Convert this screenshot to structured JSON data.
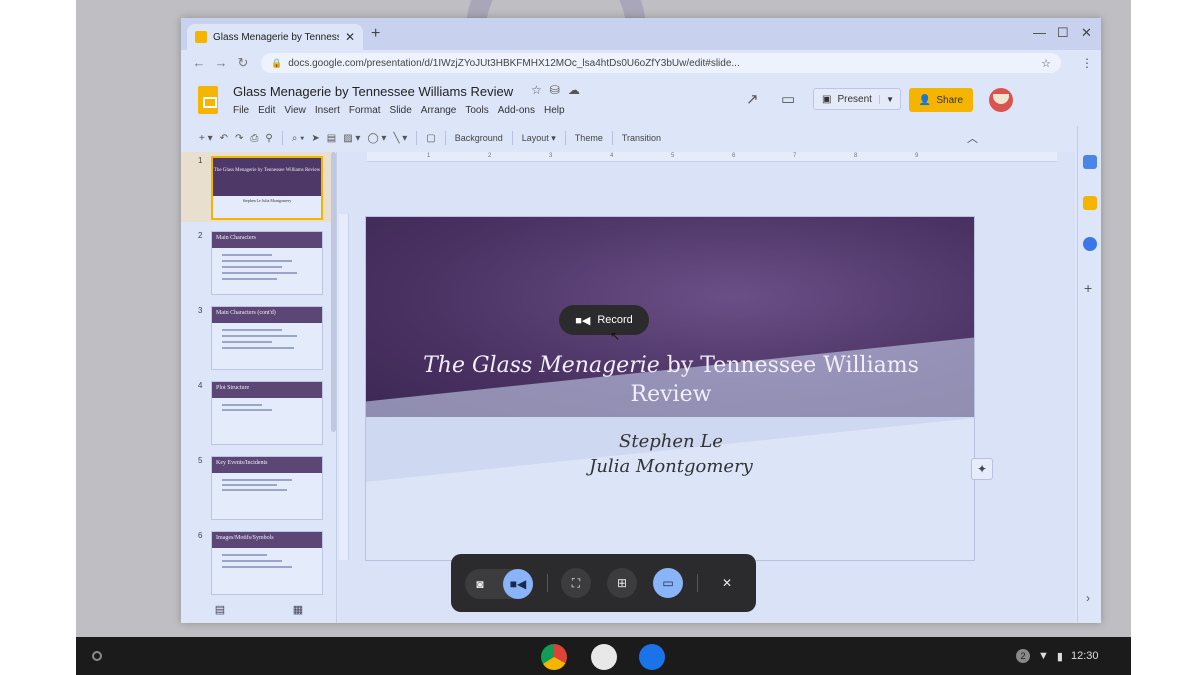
{
  "browser": {
    "tab_title": "Glass Menagerie by Tennessee Williams Review",
    "tab_close": "✕",
    "new_tab": "+",
    "url": "docs.google.com/presentation/d/1IWzjZYoJUt3HBKFMHX12MOc_lsa4htDs0U6oZfY3bUw/edit#slide...",
    "window_controls": [
      "—",
      "☐",
      "✕"
    ]
  },
  "docs": {
    "title": "Glass Menagerie by Tennessee Williams Review",
    "menu": [
      "File",
      "Edit",
      "View",
      "Insert",
      "Format",
      "Slide",
      "Arrange",
      "Tools",
      "Add-ons",
      "Help"
    ],
    "present_label": "Present",
    "share_label": "Share",
    "accent_color": "#f4b400"
  },
  "toolbar": {
    "background_label": "Background",
    "layout_label": "Layout ▾",
    "theme_label": "Theme",
    "transition_label": "Transition"
  },
  "filmstrip": {
    "slides": [
      {
        "num": "1",
        "title": "The Glass Menagerie by Tennessee Williams Review",
        "subtitle": "Stephen Le Julia Montgomery"
      },
      {
        "num": "2",
        "title": "Main Characters"
      },
      {
        "num": "3",
        "title": "Main Characters (cont'd)"
      },
      {
        "num": "4",
        "title": "Plot Structure"
      },
      {
        "num": "5",
        "title": "Key Events/Incidents"
      },
      {
        "num": "6",
        "title": "Images/Motifs/Symbols"
      }
    ]
  },
  "ruler": {
    "ticks": [
      "1",
      "2",
      "3",
      "4",
      "5",
      "6",
      "7",
      "8",
      "9"
    ]
  },
  "slide": {
    "title_italic": "The Glass Menagerie",
    "title_rest": " by Tennessee Williams",
    "title_line2": "Review",
    "author1": "Stephen Le",
    "author2": "Julia Montgomery"
  },
  "record": {
    "label": "Record"
  },
  "capture": {
    "close": "✕"
  },
  "shelf": {
    "notification_count": "2",
    "time": "12:30"
  }
}
